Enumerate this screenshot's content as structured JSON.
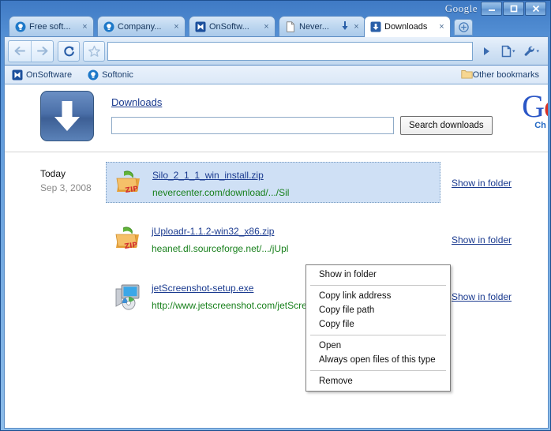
{
  "window": {
    "brand_label": "Google",
    "controls": [
      {
        "name": "minimize-button",
        "label": "–"
      },
      {
        "name": "maximize-button",
        "label": "□"
      },
      {
        "name": "close-button",
        "label": "✕"
      }
    ]
  },
  "tabs": [
    {
      "title": "Free soft...",
      "icon": "softonic-icon",
      "active": false,
      "downloading": false
    },
    {
      "title": "Company...",
      "icon": "softonic-icon",
      "active": false,
      "downloading": false
    },
    {
      "title": "OnSoftw...",
      "icon": "onsoftware-icon",
      "active": false,
      "downloading": false
    },
    {
      "title": "Never...",
      "icon": "page-icon",
      "active": false,
      "downloading": true
    },
    {
      "title": "Downloads",
      "icon": "download-icon",
      "active": true,
      "downloading": false
    }
  ],
  "tab_close_label": "×",
  "newtab_label": "+",
  "toolbar": {
    "back_title": "Back",
    "forward_title": "Forward",
    "reload_title": "Reload",
    "star_title": "Bookmark this page",
    "go_title": "Go",
    "page_menu_title": "Page menu",
    "wrench_menu_title": "Customize and control",
    "omnibox_value": "",
    "omnibox_placeholder": ""
  },
  "bookmarks": {
    "items": [
      {
        "label": "OnSoftware",
        "icon": "onsoftware-icon"
      },
      {
        "label": "Softonic",
        "icon": "softonic-icon"
      }
    ],
    "other_label": "Other bookmarks",
    "other_icon": "folder-icon"
  },
  "page": {
    "title": "Downloads",
    "big_icon": "download-arrow-icon",
    "search_value": "",
    "search_placeholder": "",
    "search_button": "Search downloads",
    "watermark": {
      "line1": "Go",
      "line2": "Ch"
    }
  },
  "downloads": {
    "date_group": {
      "label": "Today",
      "date": "Sep 3, 2008"
    },
    "show_in_folder_label": "Show in folder",
    "items": [
      {
        "filename": "Silo_2_1_1_win_install.zip",
        "url": "nevercenter.com/download/.../Sil",
        "icon": "zip-file-icon",
        "selected": true
      },
      {
        "filename": "jUploadr-1.1.2-win32_x86.zip",
        "url": "heanet.dl.sourceforge.net/.../jUpl",
        "icon": "zip-file-icon",
        "selected": false
      },
      {
        "filename": "jetScreenshot-setup.exe",
        "url": "http://www.jetscreenshot.com/jetScreenshot-setup.exe",
        "icon": "exe-file-icon",
        "selected": false
      }
    ]
  },
  "context_menu": {
    "groups": [
      {
        "items": [
          {
            "label": "Show in folder"
          }
        ]
      },
      {
        "items": [
          {
            "label": "Copy link address"
          },
          {
            "label": "Copy file path"
          },
          {
            "label": "Copy file"
          }
        ]
      },
      {
        "items": [
          {
            "label": "Open"
          },
          {
            "label": "Always open files of this type"
          }
        ]
      },
      {
        "items": [
          {
            "label": "Remove"
          }
        ]
      }
    ]
  },
  "colors": {
    "link": "#1a3a8f",
    "url_green": "#18801c",
    "selection": "#cfe0f5",
    "chrome_blue": "#2268c4"
  }
}
